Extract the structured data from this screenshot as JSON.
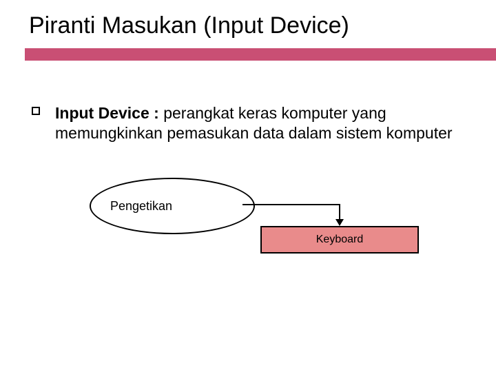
{
  "title": {
    "main": "Piranti Masukan",
    "paren": "(Input Device)"
  },
  "definition": {
    "term": "Input Device :",
    "text": " perangkat keras komputer yang memungkinkan pemasukan data dalam sistem komputer"
  },
  "nodes": {
    "category": "Pengetikan",
    "example": "Keyboard"
  },
  "colors": {
    "accent": "#c94f74",
    "rect_fill": "#e98b8b"
  }
}
